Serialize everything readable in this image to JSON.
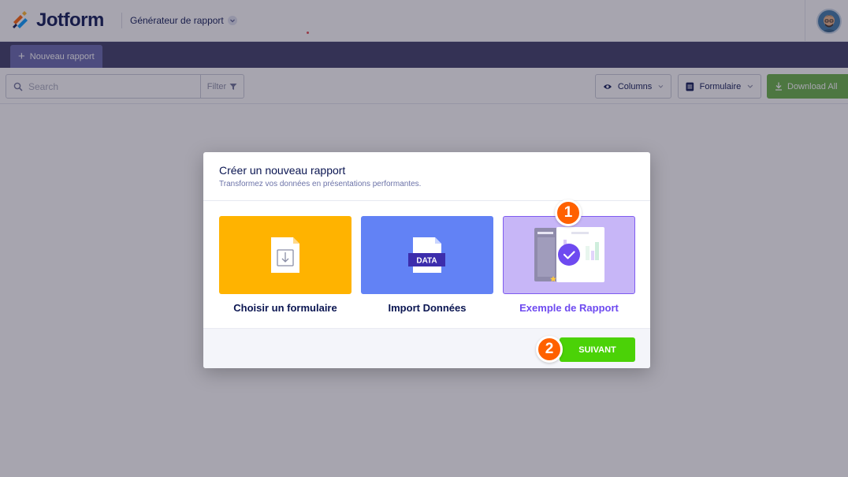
{
  "header": {
    "app_name": "Jotform",
    "product_label": "Générateur de rapport",
    "brand_color": "#0a1551",
    "avatar_icon": "user-avatar-icon"
  },
  "nav": {
    "new_report_label": "Nouveau rapport",
    "nav_color": "#3a3a64"
  },
  "toolbar": {
    "search_placeholder": "Search",
    "filter_label": "Filter",
    "columns_label": "Columns",
    "form_label": "Formulaire",
    "download_label": "Download All",
    "download_color": "#64b043"
  },
  "modal": {
    "title": "Créer un nouveau rapport",
    "subtitle": "Transformez vos données en présentations performantes.",
    "options": [
      {
        "label": "Choisir un formulaire",
        "color": "#ffb300",
        "icon": "form-import-icon",
        "selected": false
      },
      {
        "label": "Import Données",
        "color": "#6282f5",
        "icon": "data-file-icon",
        "icon_text": "DATA",
        "selected": false
      },
      {
        "label": "Exemple de Rapport",
        "color": "#c7b6f7",
        "icon": "sample-report-icon",
        "selected": true
      }
    ],
    "next_label": "SUIVANT",
    "next_color": "#4bd207"
  },
  "steps": [
    "1",
    "2"
  ]
}
